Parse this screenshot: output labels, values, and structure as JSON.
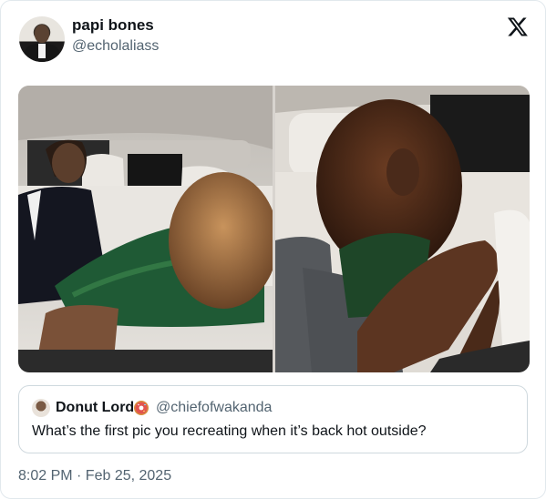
{
  "author": {
    "display_name": "papi bones",
    "handle": "@echolaliass"
  },
  "quoted": {
    "display_name": "Donut Lord",
    "emoji": "donut-icon",
    "handle": "@chiefofwakanda",
    "text": "What’s the first pic you recreating when it’s back hot outside?"
  },
  "timestamp": "8:02 PM · Feb 25, 2025",
  "icons": {
    "platform_logo": "x-logo-icon"
  },
  "colors": {
    "text_primary": "#0f1419",
    "text_secondary": "#536471",
    "border": "#cfd9de"
  }
}
